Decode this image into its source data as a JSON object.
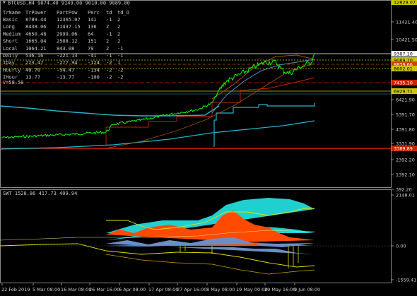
{
  "window": {
    "title_line": "BTCUSD,H4  9074.40 9149.00 9010.00 9089.00"
  },
  "info_table": {
    "headers": [
      "TrName",
      "TrPower",
      "PartPow",
      "Perc",
      "td",
      "td_O"
    ],
    "rows": [
      [
        "Basic",
        "8789.44",
        "12365.07",
        "141",
        "-1",
        "2"
      ],
      [
        "Long",
        "8438.06",
        "11437.15",
        "136",
        "2",
        "2"
      ],
      [
        "Medium",
        "4650.48",
        "2999.06",
        "64",
        "-1",
        "2"
      ],
      [
        "Short",
        "1665.04",
        "2508.12",
        "151",
        "2",
        "2"
      ],
      [
        "Local",
        "1064.21",
        "843.08",
        "79",
        "2",
        "-1"
      ],
      [
        "Daily",
        "536.16",
        "-221.13",
        "-41",
        "-1",
        "-1"
      ],
      [
        "IDay",
        "223.47",
        "-277.94",
        "-124",
        "-2",
        "1"
      ],
      [
        "Hourly",
        "40.70",
        "-54.47",
        "-134",
        "-2",
        "-2"
      ],
      [
        "IHour",
        "13.77",
        "-13.77",
        "-100",
        "-2",
        "-2"
      ]
    ],
    "vol_label": "V=58.50"
  },
  "price_axis": {
    "ticks": [
      "11421.40",
      "10421.50",
      "6421.90",
      "5391.70",
      "4391.80",
      "3331.90",
      "2392.20",
      "1392.10",
      "392.20"
    ],
    "tags": [
      {
        "text": "12829.07",
        "bg": "#c8c800",
        "fg": "#000000"
      },
      {
        "text": "9387.10",
        "bg": "#ffffff",
        "fg": "#000000"
      },
      {
        "text": "9089.70",
        "bg": "#c8c800",
        "fg": "#000000"
      },
      {
        "text": "8839.66",
        "bg": "#cc4400",
        "fg": "#ffffff"
      },
      {
        "text": "8602.01",
        "bg": "#c8c800",
        "fg": "#000000"
      },
      {
        "text": "7435.10",
        "bg": "#cc2200",
        "fg": "#ffffff"
      },
      {
        "text": "6929.71",
        "bg": "#c8c800",
        "fg": "#000000"
      },
      {
        "text": "3389.89",
        "bg": "#cc2200",
        "fg": "#ffffff"
      }
    ]
  },
  "sub_window": {
    "title_line": "SWT 1528.86 417.73 409.94",
    "ticks": [
      "2148.01",
      "0.00",
      "-1559.41"
    ]
  },
  "time_axis": {
    "labels": [
      "22 Feb 2019",
      "5 Mar 08:00",
      "16 Mar 08:00",
      "26 Mar 16:00",
      "6 Apr 08:00",
      "17 Apr 08:00",
      "27 Apr 16:00",
      "8 May 08:00",
      "19 May 00:00",
      "29 May 16:00",
      "9 Jun 08:00"
    ]
  },
  "colors": {
    "price": "#00ff00",
    "cyan": "#1fb6c8",
    "red": "#cc2200",
    "yellow": "#e0e000",
    "orange": "#ff4a00",
    "steelblue": "#6a8fc8",
    "teal": "#20d0d0"
  }
}
